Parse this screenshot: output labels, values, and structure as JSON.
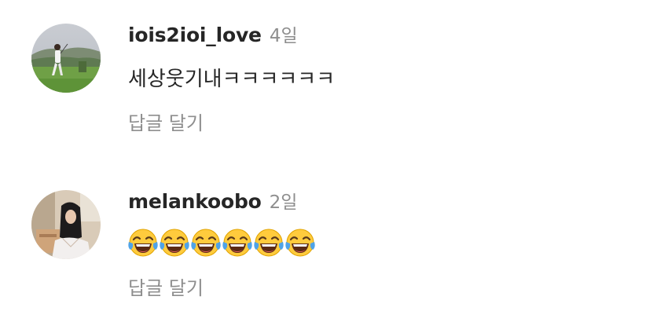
{
  "comments": [
    {
      "username": "iois2ioi_love",
      "timestamp": "4일",
      "text": "세상웃기내ㅋㅋㅋㅋㅋㅋ",
      "reply_label": "답글 달기",
      "avatar_icon": "avatar-golf-photo"
    },
    {
      "username": "melankoobo",
      "timestamp": "2일",
      "emoji_name": "face-with-tears-of-joy",
      "emoji_count": 6,
      "reply_label": "답글 달기",
      "avatar_icon": "avatar-indoor-photo"
    }
  ],
  "colors": {
    "text_primary": "#262626",
    "text_secondary": "#8e8e8e",
    "emoji_face": "#FFCB3D"
  }
}
